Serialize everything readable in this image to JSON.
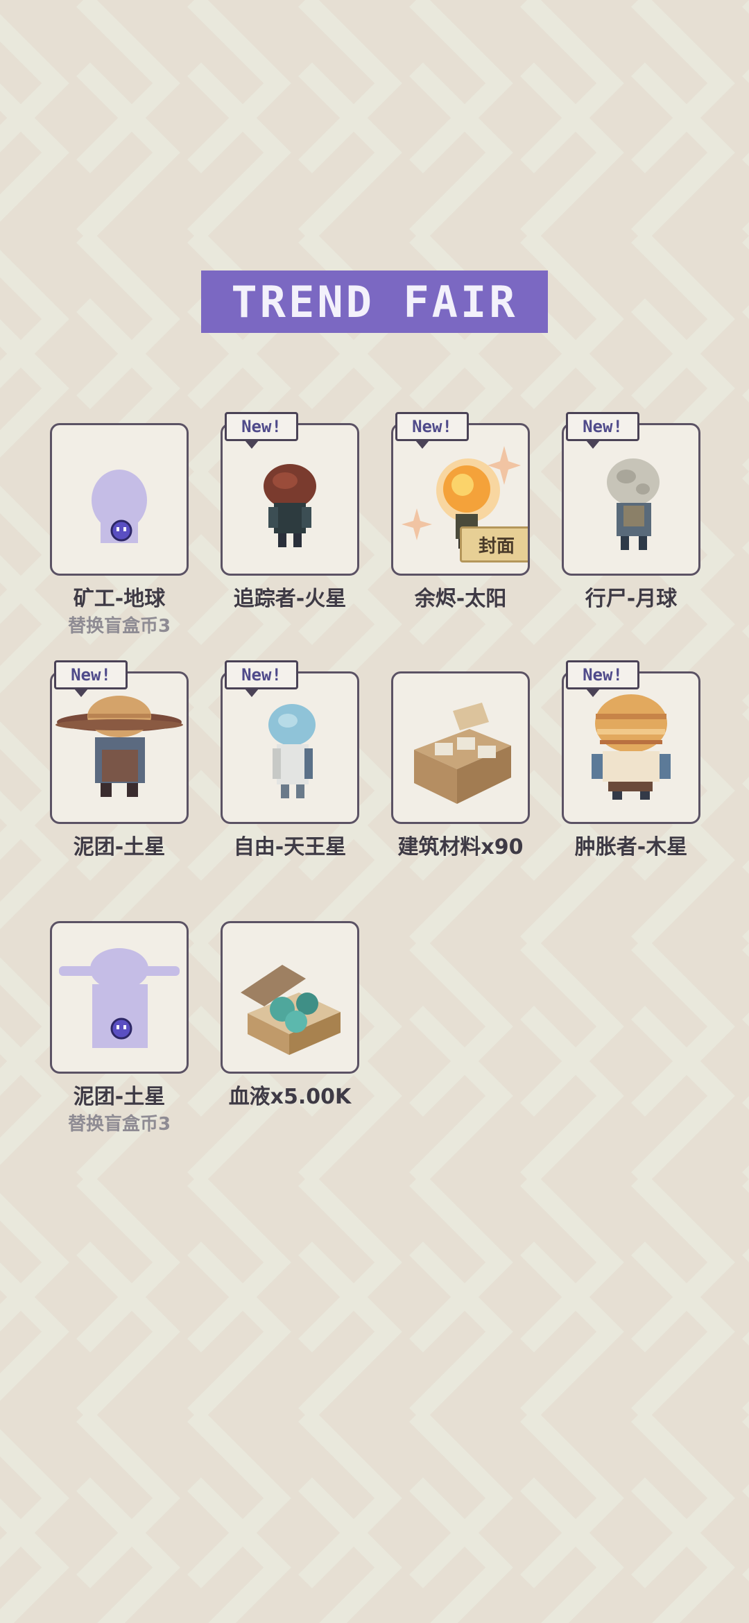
{
  "title": "TREND FAIR",
  "new_label": "New!",
  "cover_label": "封面",
  "items": [
    {
      "name": "矿工-地球",
      "sub": "替换盲盒币3",
      "is_new": false,
      "art": "silhouette-round"
    },
    {
      "name": "追踪者-火星",
      "is_new": true,
      "art": "tracker-mars"
    },
    {
      "name": "余烬-太阳",
      "is_new": true,
      "art": "ember-sun",
      "cover": true
    },
    {
      "name": "行尸-月球",
      "is_new": true,
      "art": "walker-moon"
    },
    {
      "name": "泥团-土星",
      "is_new": true,
      "art": "mud-saturn"
    },
    {
      "name": "自由-天王星",
      "is_new": true,
      "art": "free-uranus"
    },
    {
      "name": "建筑材料x90",
      "is_new": false,
      "art": "crate"
    },
    {
      "name": "肿胀者-木星",
      "is_new": true,
      "art": "bloater-jupiter"
    },
    {
      "name": "泥团-土星",
      "sub": "替换盲盒币3",
      "is_new": false,
      "art": "silhouette-ringed"
    },
    {
      "name": "血液x5.00K",
      "is_new": false,
      "art": "blood-box"
    }
  ],
  "colors": {
    "banner": "#7b68c2",
    "background": "#e6dfd3",
    "card_border": "#5b5264",
    "silhouette": "#c5bde6"
  }
}
